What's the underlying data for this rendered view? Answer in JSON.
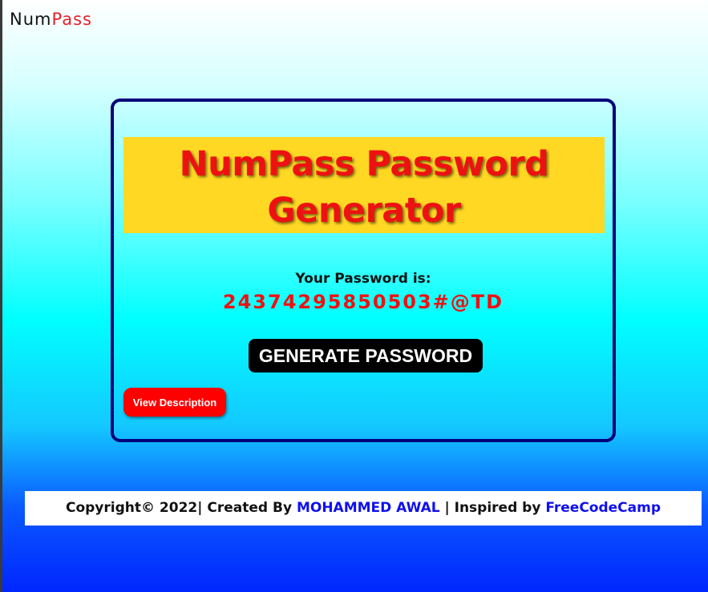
{
  "brand": {
    "logo_main": "Num",
    "logo_accent": "Pass"
  },
  "card": {
    "title_line1": "NumPass Password",
    "title_line2": "Generator",
    "password_label": "Your Password is:",
    "password_value": "24374295850503#@TD",
    "generate_button": "GENERATE PASSWORD",
    "description_button": "View Description"
  },
  "footer": {
    "copyright": "Copyright© 2022",
    "sep1": "|",
    "created_by": "Created By",
    "author": "MOHAMMED AWAL",
    "sep2": "|",
    "inspired_by": "Inspired by",
    "inspiration": "FreeCodeCamp"
  },
  "colors": {
    "accent_red": "#ee1111",
    "banner_yellow": "#ffd823",
    "card_border": "#00007a",
    "link_blue": "#1010ee"
  }
}
